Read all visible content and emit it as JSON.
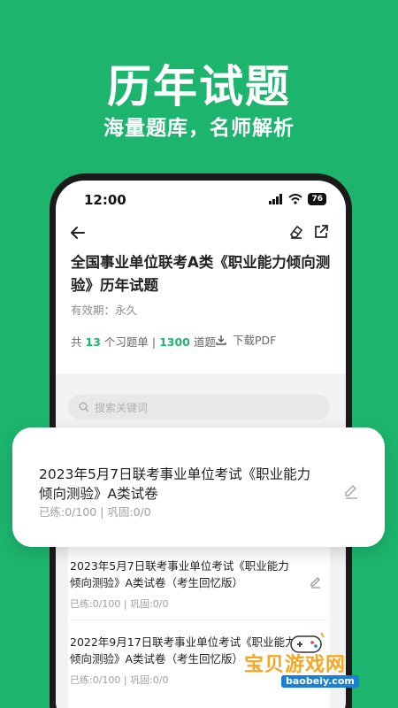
{
  "hero": {
    "title": "历年试题",
    "subtitle": "海量题库，名师解析"
  },
  "status_bar": {
    "time": "12:00",
    "battery": "76"
  },
  "header": {
    "icons": {
      "back": "arrow-left-icon",
      "eraser": "eraser-icon",
      "share": "share-icon"
    }
  },
  "doc": {
    "title": "全国事业单位联考A类《职业能力倾向测验》历年试题",
    "validity": "有效期：永久",
    "stats": {
      "prefix": "共",
      "set_count": "13",
      "set_unit": "个习题单 |",
      "question_count": "1300",
      "question_unit": "道题"
    },
    "download_label": "下载PDF"
  },
  "search": {
    "placeholder": "搜索关键词"
  },
  "featured": {
    "title": "2023年5月7日联考事业单位考试《职业能力倾向测验》A类试卷",
    "meta": "已练:0/100 | 巩固:0/0"
  },
  "list": [
    {
      "title": "2023年5月7日联考事业单位考试《职业能力倾向测验》A类试卷（考生回忆版）",
      "meta": "已练:0/100 | 巩固:0/0"
    },
    {
      "title": "2022年9月17日联考事业单位考试《职业能力倾向测验》A类试卷（考生回忆版）",
      "meta": "已练:0/100 | 巩固:0/0"
    }
  ],
  "watermark": {
    "text": "宝贝游戏网",
    "url": "baobeiy.com"
  },
  "colors": {
    "brand": "#1db56e",
    "watermark": "#f5a623"
  }
}
